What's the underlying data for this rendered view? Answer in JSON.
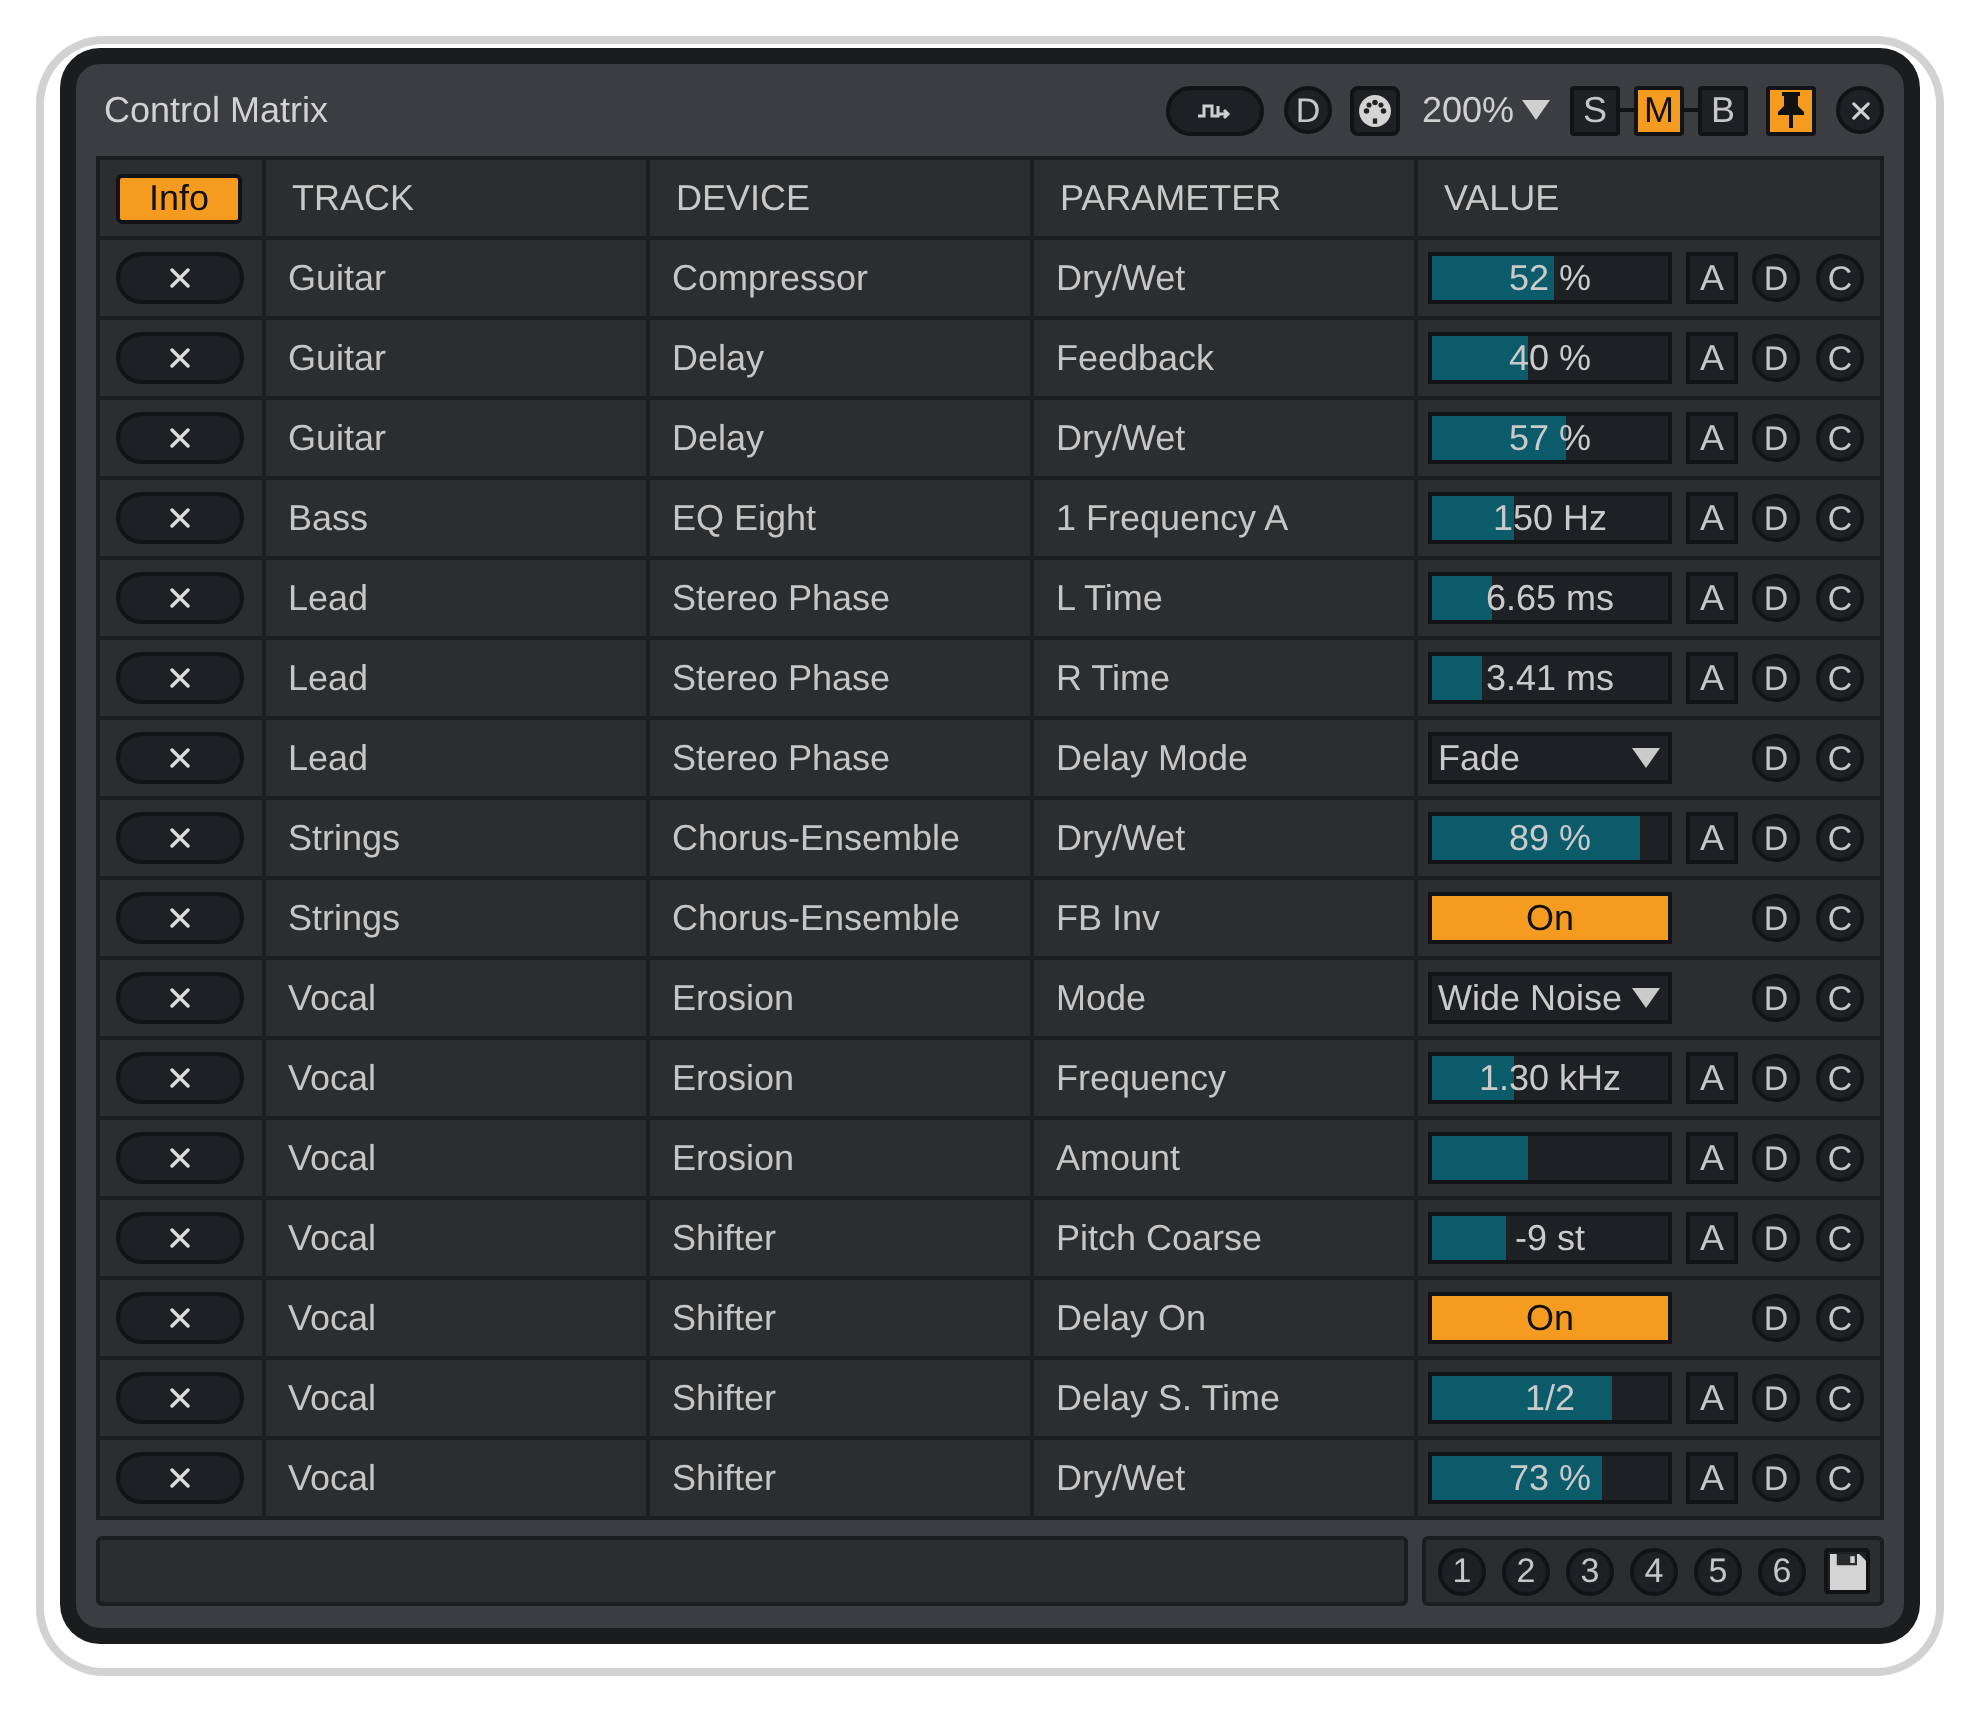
{
  "window": {
    "title": "Control Matrix"
  },
  "toolbar": {
    "device_button": "D",
    "zoom": "200%",
    "modes": [
      {
        "label": "S",
        "selected": false
      },
      {
        "label": "M",
        "selected": true
      },
      {
        "label": "B",
        "selected": false
      }
    ],
    "pin": {
      "on": true
    }
  },
  "table": {
    "info": {
      "label": "Info",
      "on": true
    },
    "columns": [
      "TRACK",
      "DEVICE",
      "PARAMETER",
      "VALUE"
    ],
    "rows": [
      {
        "track": "Guitar",
        "device": "Compressor",
        "parameter": "Dry/Wet",
        "control": {
          "kind": "slider",
          "level": 0.52,
          "reading": "52 %"
        },
        "a_button": "A",
        "d_button": "D",
        "c_button": "C"
      },
      {
        "track": "Guitar",
        "device": "Delay",
        "parameter": "Feedback",
        "control": {
          "kind": "slider",
          "level": 0.41,
          "reading": "40 %"
        },
        "a_button": "A",
        "d_button": "D",
        "c_button": "C"
      },
      {
        "track": "Guitar",
        "device": "Delay",
        "parameter": "Dry/Wet",
        "control": {
          "kind": "slider",
          "level": 0.57,
          "reading": "57 %"
        },
        "a_button": "A",
        "d_button": "D",
        "c_button": "C"
      },
      {
        "track": "Bass",
        "device": "EQ Eight",
        "parameter": "1 Frequency A",
        "control": {
          "kind": "slider",
          "level": 0.35,
          "reading": "150 Hz"
        },
        "a_button": "A",
        "d_button": "D",
        "c_button": "C"
      },
      {
        "track": "Lead",
        "device": "Stereo Phase",
        "parameter": "L Time",
        "control": {
          "kind": "slider",
          "level": 0.25,
          "reading": "6.65 ms"
        },
        "a_button": "A",
        "d_button": "D",
        "c_button": "C"
      },
      {
        "track": "Lead",
        "device": "Stereo Phase",
        "parameter": "R Time",
        "control": {
          "kind": "slider",
          "level": 0.21,
          "reading": "3.41 ms"
        },
        "a_button": "A",
        "d_button": "D",
        "c_button": "C"
      },
      {
        "track": "Lead",
        "device": "Stereo Phase",
        "parameter": "Delay Mode",
        "control": {
          "kind": "dropdown",
          "value": "Fade"
        },
        "d_button": "D",
        "c_button": "C"
      },
      {
        "track": "Strings",
        "device": "Chorus-Ensemble",
        "parameter": "Dry/Wet",
        "control": {
          "kind": "slider",
          "level": 0.88,
          "reading": "89 %"
        },
        "a_button": "A",
        "d_button": "D",
        "c_button": "C"
      },
      {
        "track": "Strings",
        "device": "Chorus-Ensemble",
        "parameter": "FB Inv",
        "control": {
          "kind": "toggle",
          "label": "On",
          "on": true
        },
        "d_button": "D",
        "c_button": "C"
      },
      {
        "track": "Vocal",
        "device": "Erosion",
        "parameter": "Mode",
        "control": {
          "kind": "dropdown",
          "value": "Wide Noise"
        },
        "d_button": "D",
        "c_button": "C"
      },
      {
        "track": "Vocal",
        "device": "Erosion",
        "parameter": "Frequency",
        "control": {
          "kind": "slider",
          "level": 0.35,
          "reading": "1.30 kHz"
        },
        "a_button": "A",
        "d_button": "D",
        "c_button": "C"
      },
      {
        "track": "Vocal",
        "device": "Erosion",
        "parameter": "Amount",
        "control": {
          "kind": "slider",
          "level": 0.41
        },
        "a_button": "A",
        "d_button": "D",
        "c_button": "C"
      },
      {
        "track": "Vocal",
        "device": "Shifter",
        "parameter": "Pitch Coarse",
        "control": {
          "kind": "slider",
          "level": 0.31,
          "reading": "-9 st"
        },
        "a_button": "A",
        "d_button": "D",
        "c_button": "C"
      },
      {
        "track": "Vocal",
        "device": "Shifter",
        "parameter": "Delay On",
        "control": {
          "kind": "toggle",
          "label": "On",
          "on": true
        },
        "d_button": "D",
        "c_button": "C"
      },
      {
        "track": "Vocal",
        "device": "Shifter",
        "parameter": "Delay S. Time",
        "control": {
          "kind": "slider",
          "level": 0.76,
          "reading": "1/2"
        },
        "a_button": "A",
        "d_button": "D",
        "c_button": "C"
      },
      {
        "track": "Vocal",
        "device": "Shifter",
        "parameter": "Dry/Wet",
        "control": {
          "kind": "slider",
          "level": 0.72,
          "reading": "73 %"
        },
        "a_button": "A",
        "d_button": "D",
        "c_button": "C"
      }
    ]
  },
  "footer": {
    "slots": [
      "1",
      "2",
      "3",
      "4",
      "5",
      "6"
    ]
  }
}
